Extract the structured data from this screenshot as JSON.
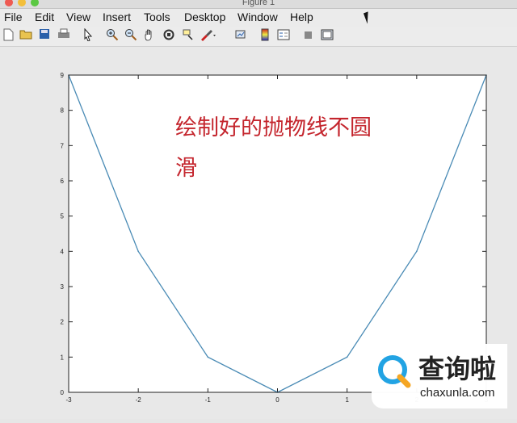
{
  "window": {
    "title": "Figure 1"
  },
  "menu": [
    "File",
    "Edit",
    "View",
    "Insert",
    "Tools",
    "Desktop",
    "Window",
    "Help"
  ],
  "toolbar": {
    "icons": [
      "new-figure-icon",
      "open-file-icon",
      "save-icon",
      "print-icon",
      "pointer-icon",
      "zoom-in-icon",
      "zoom-out-icon",
      "pan-icon",
      "rotate-3d-icon",
      "data-cursor-icon",
      "brush-icon",
      "link-plot-icon",
      "colorbar-icon",
      "legend-icon",
      "hide-plot-tools-icon",
      "show-plot-tools-icon"
    ]
  },
  "annotation": {
    "line1": "绘制好的抛物线不圆",
    "line2": "滑"
  },
  "watermark": {
    "name": "查询啦",
    "site": "chaxunla.com"
  },
  "chart_data": {
    "type": "line",
    "x": [
      -3,
      -2,
      -1,
      0,
      1,
      2,
      3
    ],
    "series": [
      {
        "values": [
          9,
          4,
          1,
          0,
          1,
          4,
          9
        ],
        "color": "#4a8bb5"
      }
    ],
    "xlim": [
      -3,
      3
    ],
    "ylim": [
      0,
      9
    ],
    "xticks": [
      "-3",
      "-2",
      "-1",
      "0",
      "1",
      "2",
      "3"
    ],
    "yticks": [
      "0",
      "1",
      "2",
      "3",
      "4",
      "5",
      "6",
      "7",
      "8",
      "9"
    ],
    "grid": false
  }
}
